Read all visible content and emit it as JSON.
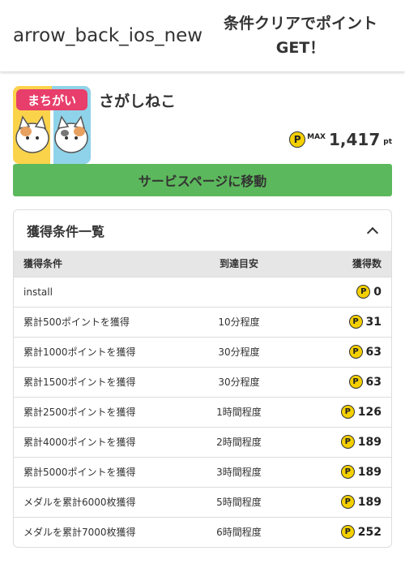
{
  "header": {
    "back_label": "arrow_back_ios_new",
    "title_line1": "条件クリアでポイント",
    "title_line2": "GET！"
  },
  "app": {
    "name": "さがしねこ",
    "icon_text": "まちがい",
    "max_label": "MAX",
    "max_points": "1,417",
    "pt_unit": "pt",
    "coin_symbol": "P"
  },
  "service_button": "サービスページに移動",
  "conditions": {
    "title": "獲得条件一覧",
    "columns": [
      "獲得条件",
      "到達目安",
      "獲得数"
    ],
    "rows": [
      {
        "condition": "install",
        "eta": "",
        "points": "0"
      },
      {
        "condition": "累計500ポイントを獲得",
        "eta": "10分程度",
        "points": "31"
      },
      {
        "condition": "累計1000ポイントを獲得",
        "eta": "30分程度",
        "points": "63"
      },
      {
        "condition": "累計1500ポイントを獲得",
        "eta": "30分程度",
        "points": "63"
      },
      {
        "condition": "累計2500ポイントを獲得",
        "eta": "1時間程度",
        "points": "126"
      },
      {
        "condition": "累計4000ポイントを獲得",
        "eta": "2時間程度",
        "points": "189"
      },
      {
        "condition": "累計5000ポイントを獲得",
        "eta": "3時間程度",
        "points": "189"
      },
      {
        "condition": "メダルを累計6000枚獲得",
        "eta": "5時間程度",
        "points": "189"
      },
      {
        "condition": "メダルを累計7000枚獲得",
        "eta": "6時間程度",
        "points": "252"
      }
    ]
  }
}
